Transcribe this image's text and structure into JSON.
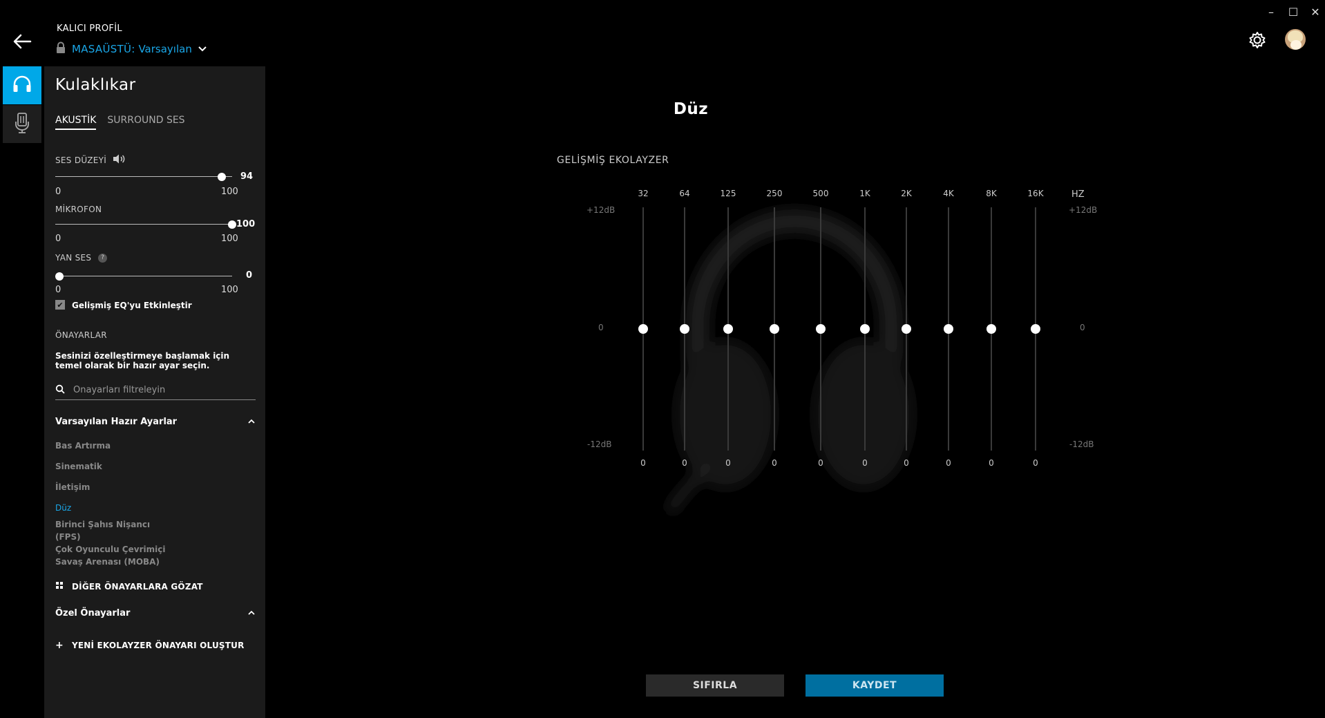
{
  "window": {
    "controls": {
      "minimize": "–",
      "maximize": "☐",
      "close": "✕"
    }
  },
  "header": {
    "profile_label": "KALICI PROFİL",
    "profile_device": "MASAÜSTÜ:",
    "profile_name": "Varsayılan"
  },
  "panel": {
    "title": "Kulaklıkar",
    "tabs": [
      "AKUSTİK",
      "SURROUND SES"
    ],
    "active_tab": "AKUSTİK",
    "volume": {
      "label": "SES DÜZEYİ",
      "value": "94",
      "min": "0",
      "max": "100"
    },
    "mic": {
      "label": "MİKROFON",
      "value": "100",
      "min": "0",
      "max": "100"
    },
    "sidetone": {
      "label": "YAN SES",
      "help": "?",
      "value": "0",
      "min": "0",
      "max": "100"
    },
    "advanced_eq_label": "Gelişmiş EQ'yu Etkinleştir",
    "advanced_eq_checked": true,
    "presets_heading": "ÖNAYARLAR",
    "presets_desc": "Sesinizi özelleştirmeye başlamak için temel olarak bir hazır ayar seçin.",
    "search_placeholder": "Önayarları filtreleyin",
    "default_group": {
      "title": "Varsayılan Hazır Ayarlar",
      "items": [
        "Bas Artırma",
        "Sinematik",
        "İletişim",
        "Düz",
        "Birinci Şahıs Nişancı (FPS)",
        "Çok Oyunculu Çevrimiçi Savaş Arenası (MOBA)"
      ],
      "active": "Düz"
    },
    "browse_label": "DİĞER ÖNAYARLARA GÖZAT",
    "custom_group_title": "Özel Önayarlar",
    "new_preset_label": "YENİ EKOLAYZER ÖNAYARI OLUŞTUR"
  },
  "main": {
    "title": "Düz",
    "eq_title": "GELİŞMİŞ EKOLAYZER",
    "hz_label": "HZ",
    "db_top": "+12dB",
    "db_mid": "0",
    "db_bottom": "-12dB",
    "reset_label": "SIFIRLA",
    "save_label": "KAYDET"
  },
  "eq": {
    "bands": [
      "32",
      "64",
      "125",
      "250",
      "500",
      "1K",
      "2K",
      "4K",
      "8K",
      "16K"
    ],
    "gains_db": [
      0,
      0,
      0,
      0,
      0,
      0,
      0,
      0,
      0,
      0
    ],
    "range_db": [
      -12,
      12
    ]
  },
  "colors": {
    "accent": "#00a8e8",
    "panel": "#1b1b1b",
    "save": "#006fa0"
  }
}
